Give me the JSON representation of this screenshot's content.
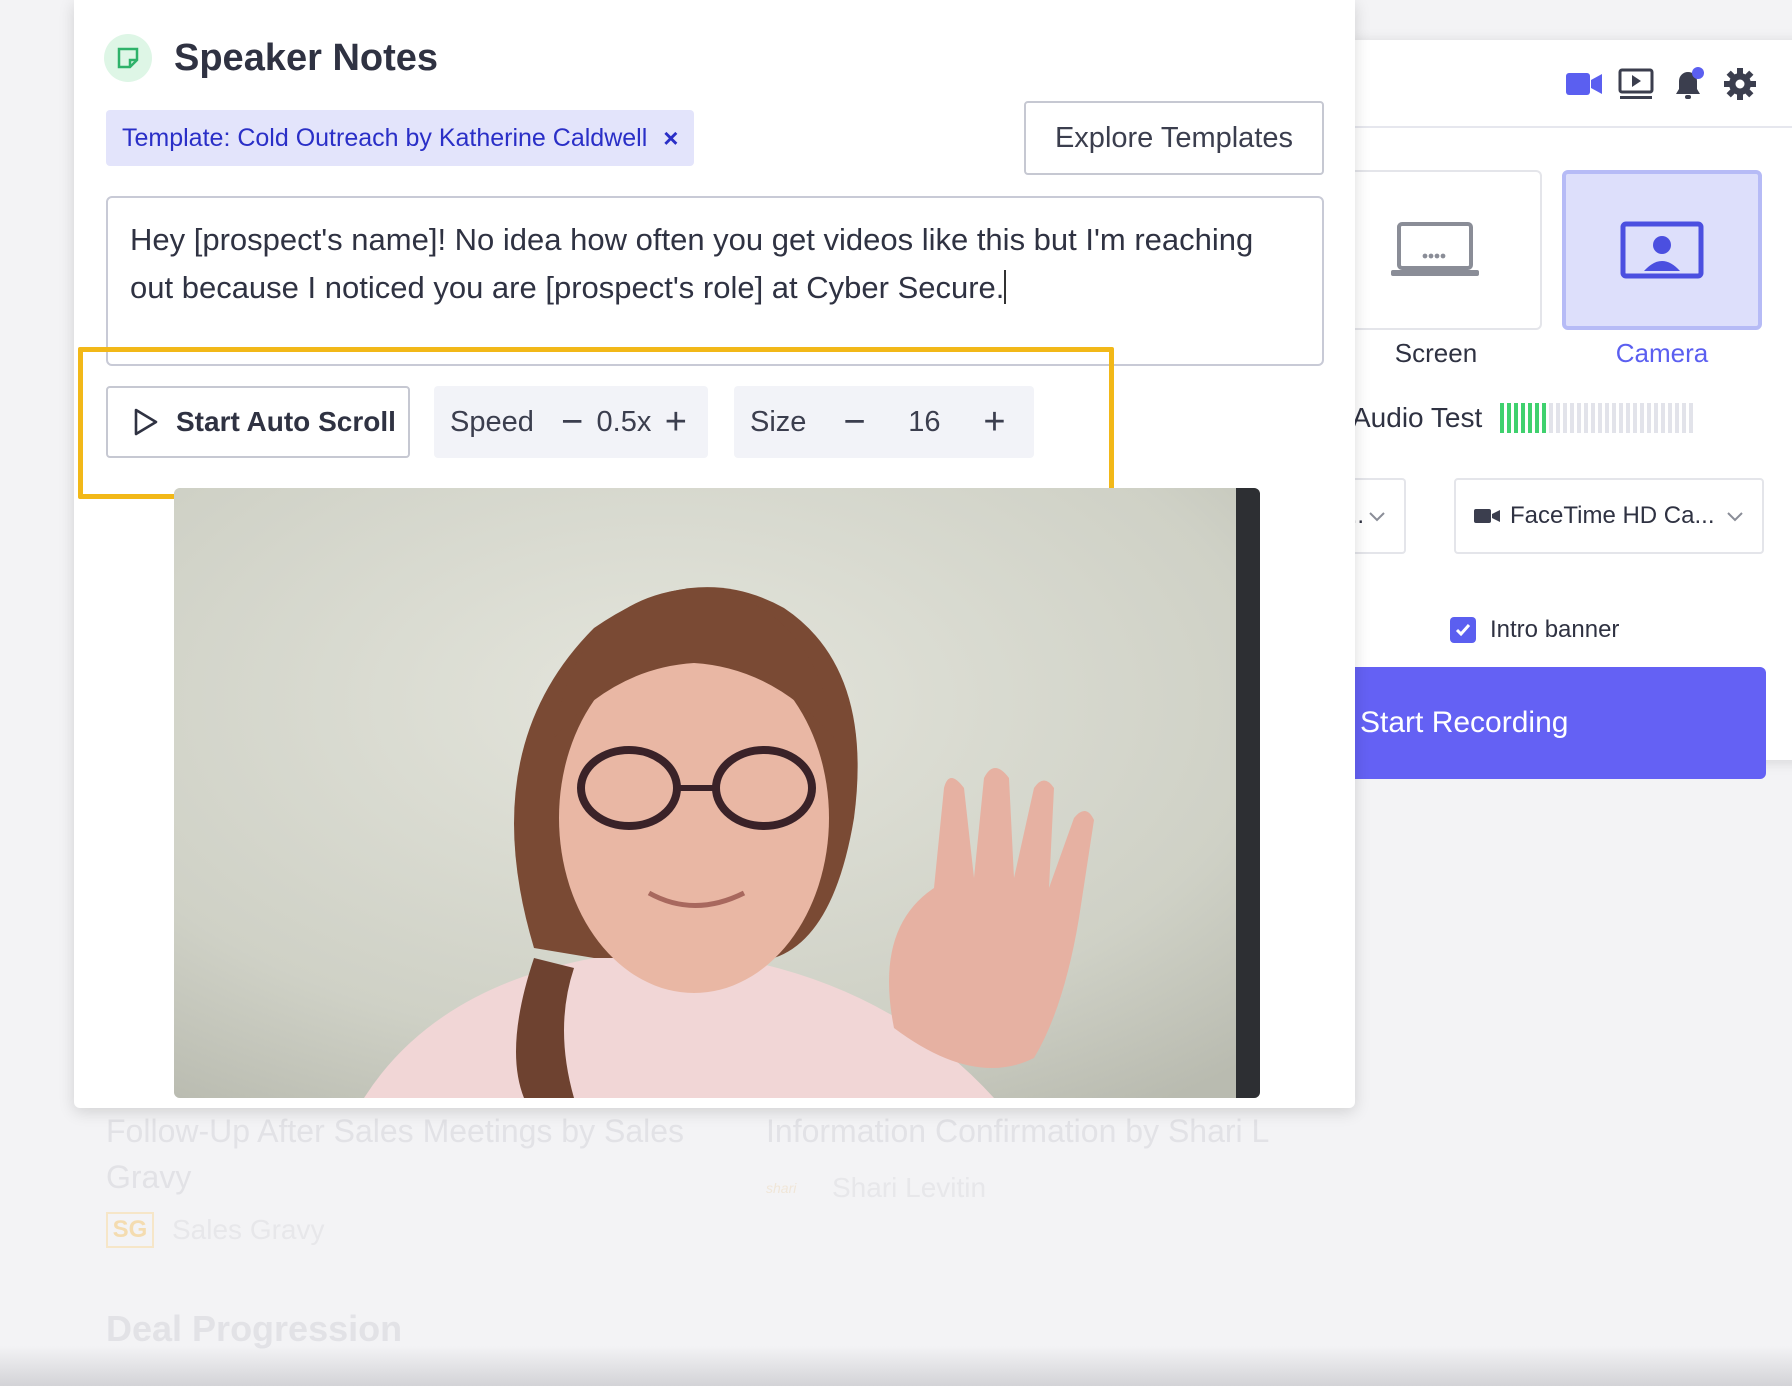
{
  "background": {
    "cards": [
      {
        "title": "Follow-Up After Sales Meetings by Sales Gravy",
        "author": "Sales Gravy",
        "logo": "SG"
      },
      {
        "title": "Information Confirmation by Shari L",
        "author": "Shari Levitin",
        "logo": "shari"
      }
    ],
    "section_heading": "Deal Progression"
  },
  "speaker_notes": {
    "title": "Speaker Notes",
    "icon": "sticky-note-icon",
    "template_chip": "Template: Cold Outreach by Katherine Caldwell",
    "chip_close": "×",
    "explore_button": "Explore Templates",
    "script_text": "Hey [prospect's name]! No idea how often you get videos like this but I'm reaching out because I noticed you are [prospect's role] at Cyber Secure.",
    "auto_scroll_label": "Start Auto Scroll",
    "speed": {
      "label": "Speed",
      "value": "0.5x",
      "minus": "−",
      "plus": "+"
    },
    "size": {
      "label": "Size",
      "value": "16",
      "minus": "−",
      "plus": "+"
    },
    "highlight_color": "#f2b818"
  },
  "recorder": {
    "toolbar_icons": [
      "video-camera-icon",
      "screen-record-icon",
      "notification-bell-icon",
      "settings-gear-icon"
    ],
    "sources": [
      {
        "label": "Screen",
        "icon": "laptop-icon",
        "selected": false
      },
      {
        "label": "Camera",
        "icon": "camera-user-icon",
        "selected": true
      }
    ],
    "audio_test_label": "Audio Test",
    "audio_level": 0.25,
    "mic_select_value": "...",
    "camera_select_value": "FaceTime HD Ca...",
    "intro_banner_label": "Intro banner",
    "intro_banner_checked": true,
    "start_recording_label": "Start Recording",
    "accent_color": "#6461f4"
  }
}
